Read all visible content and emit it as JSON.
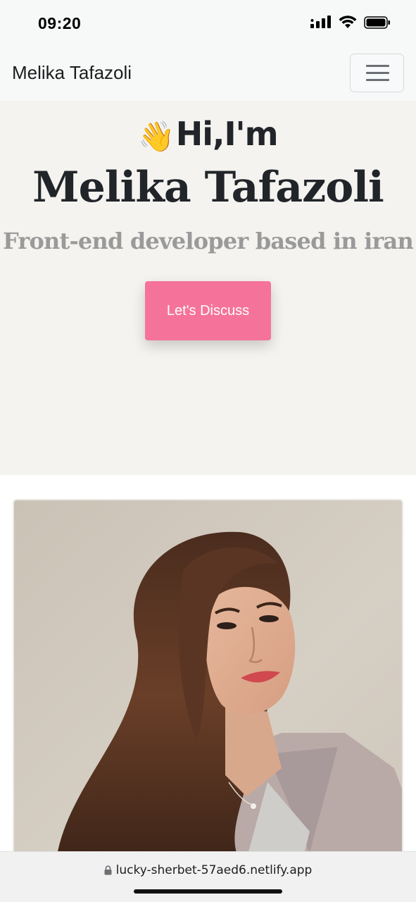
{
  "status_bar": {
    "time": "09:20",
    "icons": [
      "signal-icon",
      "wifi-icon",
      "battery-icon"
    ]
  },
  "navbar": {
    "brand": "Melika Tafazoli",
    "menu_icon": "hamburger-menu-icon"
  },
  "hero": {
    "wave_emoji": "👋",
    "greeting": "Hi,I'm",
    "name": "Melika Tafazoli",
    "subtitle": "Front-end developer based in iran",
    "cta_label": "Let's Discuss"
  },
  "profile": {
    "image": "profile-photo"
  },
  "browser": {
    "url": "lucky-sherbet-57aed6.netlify.app"
  },
  "colors": {
    "hero_bg": "#f4f3f0",
    "navbar_bg": "#f7f8f8",
    "accent": "#f5739a",
    "heading": "#212529",
    "subtitle": "#9a9a9a"
  }
}
